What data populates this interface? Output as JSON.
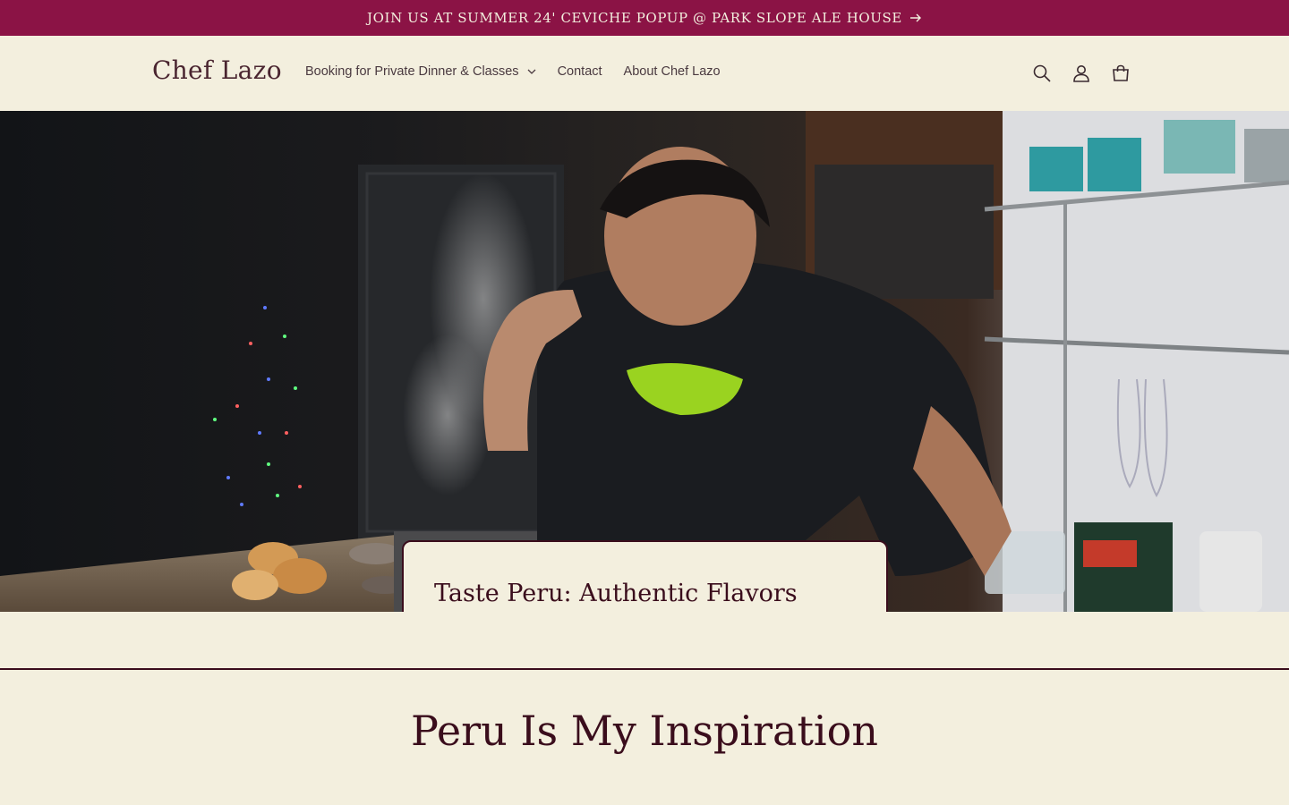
{
  "announcement": {
    "text": "JOIN US AT SUMMER 24' CEVICHE POPUP @ PARK SLOPE ALE HOUSE",
    "arrow_icon": "arrow-right-icon"
  },
  "header": {
    "logo": "Chef Lazo",
    "nav": [
      {
        "label": "Booking for Private Dinner & Classes",
        "has_dropdown": true
      },
      {
        "label": "Contact"
      },
      {
        "label": "About Chef Lazo"
      }
    ],
    "icons": [
      "search-icon",
      "account-icon",
      "cart-icon"
    ]
  },
  "hero": {
    "image_alt": "Chef Lazo cooking in a kitchen",
    "heading": "Taste Peru: Authentic Flavors with Chef Lazo"
  },
  "section": {
    "title": "Peru Is My Inspiration"
  },
  "colors": {
    "announcement_bg": "#8b1345",
    "page_bg": "#f3efde",
    "text_dark": "#3a0d1c"
  }
}
